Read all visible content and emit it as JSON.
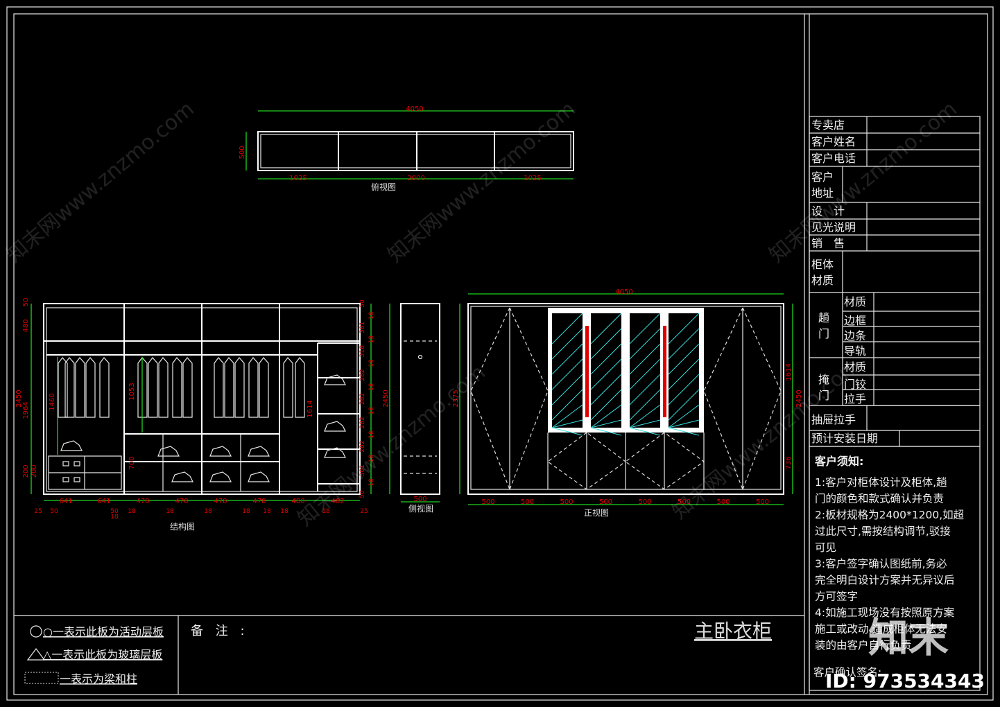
{
  "colors": {
    "background": "#000000",
    "lines": "#ffffff",
    "dimension_lines": "#1fd41f",
    "dimension_text": "#e00000",
    "glass_hatch": "#35e0e0",
    "handle": "#e00000"
  },
  "top_view": {
    "label": "俯视图",
    "width_dim": "4050",
    "depth_dim": "500",
    "segment_dims": [
      "1025",
      "2000",
      "1025"
    ]
  },
  "structure_view": {
    "label": "结构图",
    "left_dims": [
      "50",
      "480",
      "2450",
      "1964",
      "200",
      "200"
    ],
    "inner_dims": [
      "1460",
      "1053",
      "700",
      "1614"
    ],
    "right_dims": [
      "50",
      "18",
      "381",
      "18",
      "318",
      "18",
      "282",
      "18",
      "282",
      "18",
      "282",
      "18",
      "282",
      "18",
      "301",
      "18",
      "50"
    ],
    "bottom_dims": [
      "641",
      "641",
      "478",
      "478",
      "478",
      "478",
      "480",
      "482"
    ],
    "board_dims": [
      "25",
      "50",
      "50",
      "18",
      "18",
      "18",
      "18",
      "18",
      "18",
      "18",
      "18",
      "25"
    ]
  },
  "side_view": {
    "label": "侧视图",
    "depth_dim": "500",
    "height_dim": "2450"
  },
  "front_view": {
    "label": "正视图",
    "width_dim": "4050",
    "left_dim": "2375",
    "right_dims": [
      "1614",
      "2450",
      "736"
    ],
    "door_dims": [
      "500",
      "500",
      "500",
      "500",
      "500",
      "500",
      "500",
      "500"
    ]
  },
  "title_block": {
    "rows": [
      {
        "label": "专卖店",
        "value": ""
      },
      {
        "label": "客户姓名",
        "value": ""
      },
      {
        "label": "客户电话",
        "value": ""
      },
      {
        "label": "客户\n地址",
        "value": ""
      },
      {
        "label": "设　计",
        "value": ""
      },
      {
        "label": "见光说明",
        "value": ""
      },
      {
        "label": "销　售",
        "value": ""
      },
      {
        "label": "柜体\n材质",
        "value": ""
      }
    ],
    "sliding_door": {
      "group": "趟\n门",
      "items": [
        "材质",
        "边框",
        "边条",
        "导轨"
      ]
    },
    "hinged_door": {
      "group": "掩\n门",
      "items": [
        "材质",
        "门铰",
        "拉手"
      ]
    },
    "drawer_handle": "抽屉拉手",
    "install_date": "预计安装日期",
    "notice_title": "客户须知:",
    "notice_lines": [
      "1:客户对柜体设计及柜体,趟",
      "门的颜色和款式确认并负责",
      "2:板材规格为2400*1200,如超",
      "过此尺寸,需按结构调节,驳接",
      "可见",
      "3:客户签字确认图纸前,务必",
      "完全明白设计方案并无异议后",
      "方可签字",
      "4:如施工现场没有按照原方案",
      "施工或改动,造成柜体无法安",
      "装的由客户自行负责"
    ],
    "signature_label": "客户确认签名:"
  },
  "legend": [
    "○一表示此板为活动层板",
    "△一表示此板为玻璃层板",
    "一表示为梁和柱"
  ],
  "remarks_label": "备 注 :",
  "drawing_title": "主卧衣柜",
  "watermark": {
    "text": "知末网www.znzmo.com",
    "logo": "知末",
    "id": "ID: 973534343"
  }
}
